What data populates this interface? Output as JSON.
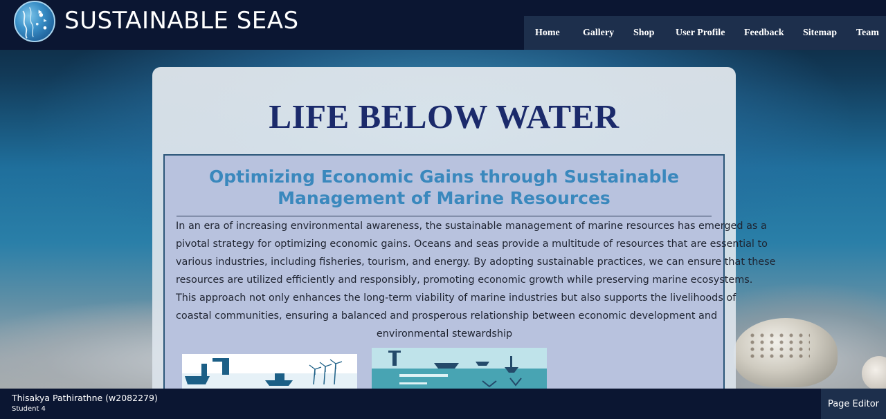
{
  "site": {
    "brand": "SUSTAINABLE SEAS",
    "logo_icon": "ocean-globe-logo"
  },
  "nav": {
    "items": [
      {
        "label": "Home"
      },
      {
        "label": "Gallery"
      },
      {
        "label": "Shop"
      },
      {
        "label": "User Profile"
      },
      {
        "label": "Feedback"
      },
      {
        "label": "Sitemap"
      },
      {
        "label": "Team"
      }
    ]
  },
  "main": {
    "title": "LIFE BELOW WATER",
    "subtitle_lines": [
      "Optimizing Economic Gains through Sustainable",
      "Management of Marine Resources"
    ],
    "paragraph_lines": [
      "In an era of increasing environmental awareness, the sustainable management of marine resources has emerged as a",
      "pivotal strategy for optimizing economic gains. Oceans and seas provide a multitude of resources that are essential to",
      "various industries, including fisheries, tourism, and energy. By adopting sustainable practices, we can ensure that these",
      "resources are utilized efficiently and responsibly, promoting economic growth while preserving marine ecosystems.",
      "This approach not only enhances the long-term viability of marine industries but also supports the livelihoods of",
      "coastal communities, ensuring a balanced and prosperous relationship between economic development and",
      "environmental stewardship"
    ],
    "images": [
      {
        "icon": "marine-industry-illustration"
      },
      {
        "icon": "ocean-economy-infographic"
      }
    ]
  },
  "footer": {
    "name": "Thisakya Pathirathne (w2082279)",
    "role": "Student 4",
    "editor_button": "Page Editor"
  },
  "colors": {
    "header_bg": "#0b1632",
    "nav_bg": "#1d2f4c",
    "title": "#1b2a6b",
    "subtitle": "#3a88bd",
    "inner_panel": "#b8c2de"
  }
}
